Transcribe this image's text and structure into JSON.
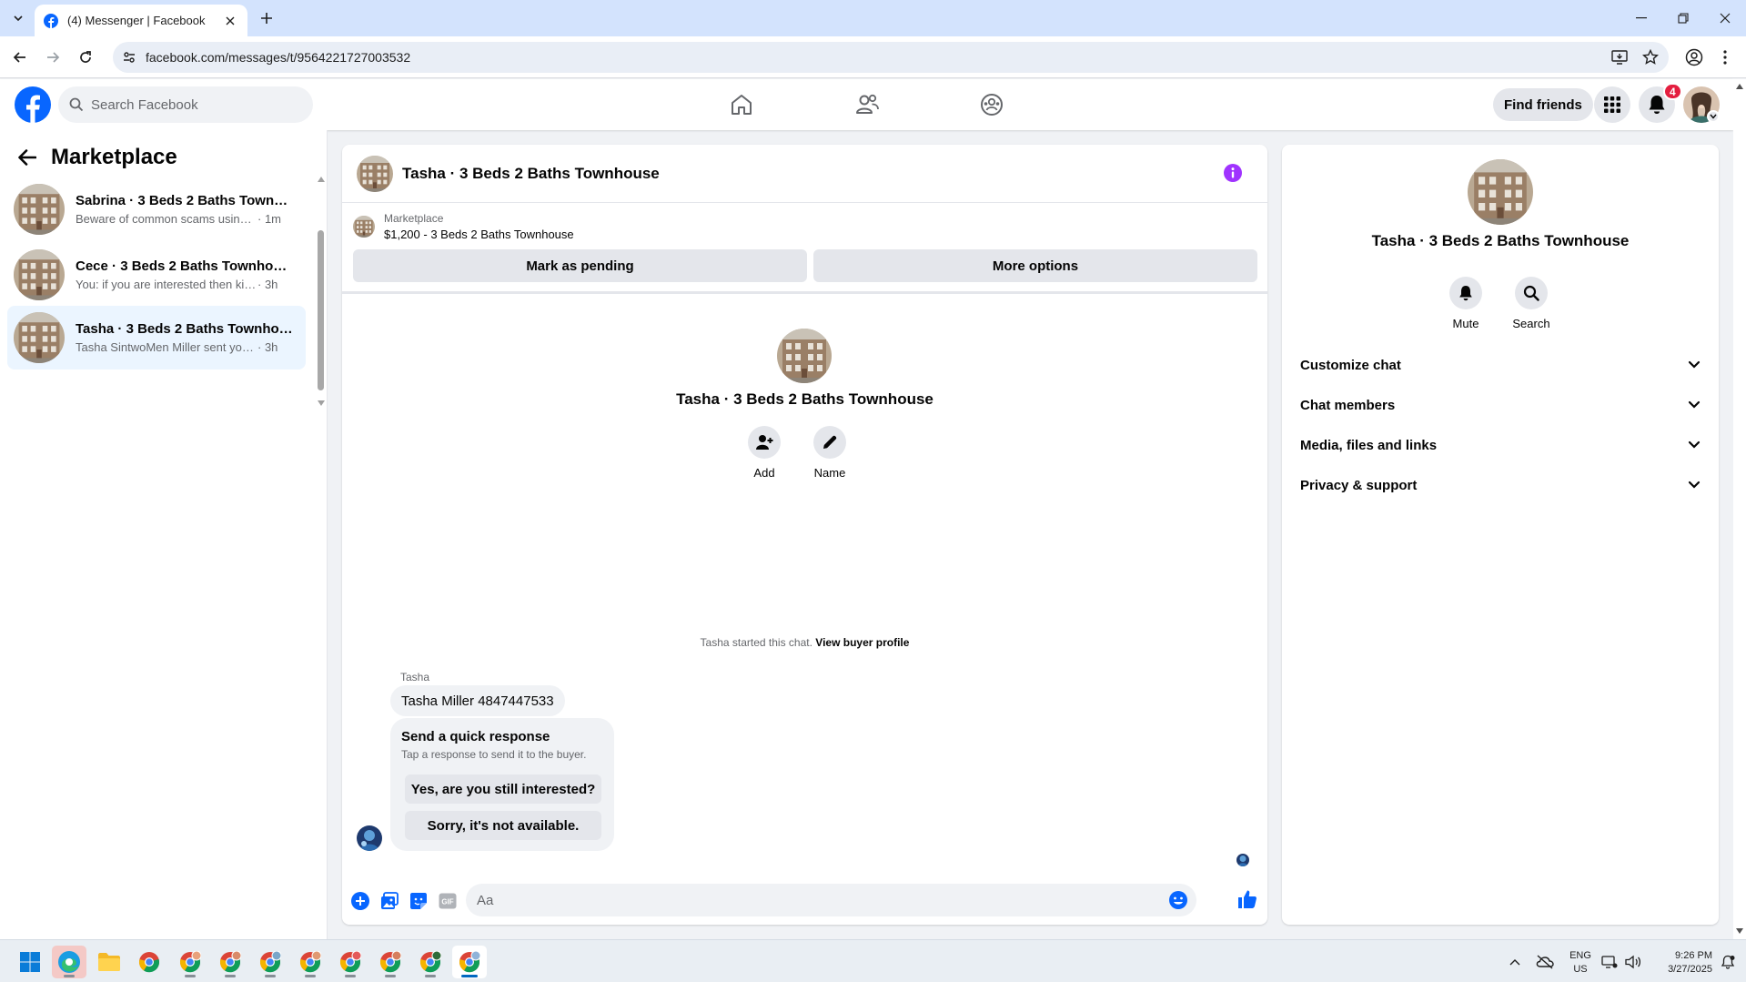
{
  "browser": {
    "tab_title": "(4) Messenger | Facebook",
    "url": "facebook.com/messages/t/9564221727003532"
  },
  "header": {
    "search_placeholder": "Search Facebook",
    "find_friends": "Find friends",
    "notification_count": "4"
  },
  "sidebar": {
    "title": "Marketplace",
    "conversations": [
      {
        "name": "Sabrina · 3 Beds 2 Baths Townho...",
        "snippet": "Beware of common scams using p...",
        "time": " · 1m",
        "active": false
      },
      {
        "name": "Cece · 3 Beds 2 Baths Townhouse",
        "snippet": "You: if you are interested then kindl...",
        "time": " · 3h",
        "active": false
      },
      {
        "name": "Tasha · 3 Beds 2 Baths Townhouse",
        "snippet": "Tasha SintwoMen Miller sent you a ...",
        "time": " · 3h",
        "active": true
      }
    ]
  },
  "chat": {
    "title": "Tasha · 3 Beds 2 Baths Townhouse",
    "listing_label": "Marketplace",
    "listing_price": "$1,200 - 3 Beds 2 Baths Townhouse",
    "mark_pending": "Mark as pending",
    "more_options": "More options",
    "intro_name": "Tasha · 3 Beds 2 Baths Townhouse",
    "add_label": "Add",
    "name_label": "Name",
    "system_text": "Tasha started this chat.",
    "system_link": "View buyer profile",
    "sender": "Tasha",
    "message": "Tasha Miller 4847447533",
    "quick_title": "Send a quick response",
    "quick_sub": "Tap a response to send it to the buyer.",
    "quick_1": "Yes, are you still interested?",
    "quick_2": "Sorry, it's not available.",
    "input_placeholder": "Aa"
  },
  "info": {
    "name": "Tasha · 3 Beds 2 Baths Townhouse",
    "mute": "Mute",
    "search": "Search",
    "sections": [
      "Customize chat",
      "Chat members",
      "Media, files and links",
      "Privacy & support"
    ]
  },
  "tray": {
    "lang1": "ENG",
    "lang2": "US",
    "time": "9:26 PM",
    "date": "3/27/2025"
  },
  "colors": {
    "fb_blue": "#0866ff",
    "messenger_purple": "#a033ff",
    "active_convo": "#ebf5ff"
  }
}
